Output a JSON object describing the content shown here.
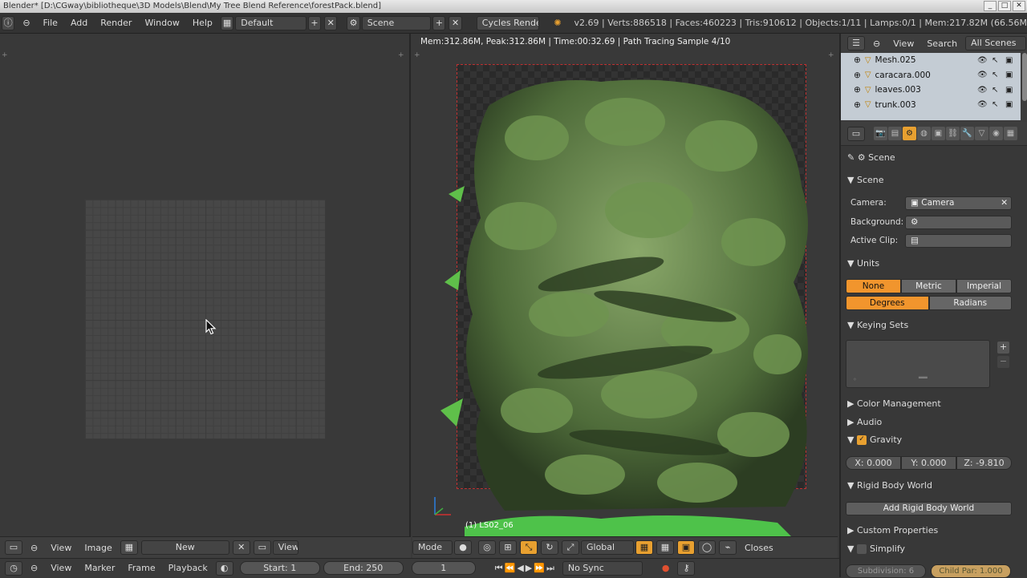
{
  "window": {
    "title": "Blender* [D:\\CGway\\bibliotheque\\3D Models\\Blend\\My Tree Blend Reference\\forestPack.blend]",
    "minimize": "_",
    "maximize": "□",
    "close": "✕"
  },
  "infobar": {
    "menus": [
      "File",
      "Add",
      "Render",
      "Window",
      "Help"
    ],
    "screen_layout": "Default",
    "scene": "Scene",
    "render_engine": "Cycles Render",
    "stats": "v2.69 | Verts:886518 | Faces:460223 | Tris:910612 | Objects:1/11 | Lamps:0/1 | Mem:217.82M (66.56M"
  },
  "render": {
    "status": "Mem:312.86M, Peak:312.86M | Time:00:32.69 | Path Tracing Sample 4/10",
    "frame_label": "(1) LS02_06"
  },
  "image_editor_header": {
    "view": "View",
    "image": "Image",
    "new_button": "New",
    "view_dropdown": "View"
  },
  "viewport_header": {
    "mode": "Mode",
    "orientation": "Global",
    "closest": "Closes"
  },
  "timeline": {
    "view": "View",
    "marker": "Marker",
    "frame": "Frame",
    "playback": "Playback",
    "start": "Start: 1",
    "end": "End: 250",
    "current": "1",
    "sync": "No Sync"
  },
  "outliner": {
    "view": "View",
    "search": "Search",
    "filter": "All Scenes",
    "items": [
      {
        "name": "Mesh.025"
      },
      {
        "name": "caracara.000"
      },
      {
        "name": "leaves.003"
      },
      {
        "name": "trunk.003"
      }
    ]
  },
  "properties": {
    "breadcrumb": "Scene",
    "scene_panel": {
      "title": "Scene",
      "camera_label": "Camera:",
      "camera_value": "Camera",
      "background_label": "Background:",
      "active_clip_label": "Active Clip:"
    },
    "units_panel": {
      "title": "Units",
      "systems": [
        "None",
        "Metric",
        "Imperial"
      ],
      "active_system": "None",
      "rotation": [
        "Degrees",
        "Radians"
      ],
      "active_rotation": "Degrees"
    },
    "keying_sets": {
      "title": "Keying Sets"
    },
    "color_management": "Color Management",
    "audio": "Audio",
    "gravity": {
      "title": "Gravity",
      "enabled": true,
      "x": "X: 0.000",
      "y": "Y: 0.000",
      "z": "Z: -9.810"
    },
    "rigid_body": {
      "title": "Rigid Body World",
      "button": "Add Rigid Body World"
    },
    "custom_properties": "Custom Properties",
    "simplify": {
      "title": "Simplify",
      "subdivision": "Subdivision: 6",
      "child_particles": "Child Par: 1.000"
    }
  },
  "colors": {
    "accent": "#f1952d",
    "background": "#393939",
    "outliner_bg": "#c4ccd4"
  }
}
